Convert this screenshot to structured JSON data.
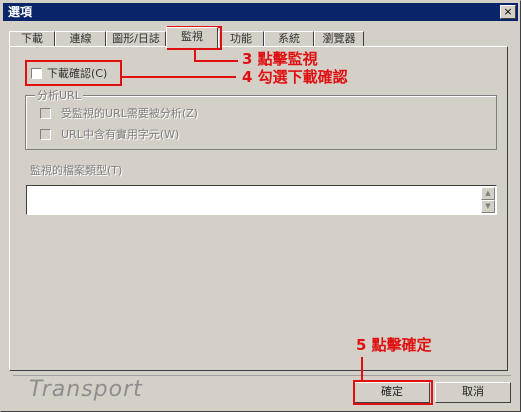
{
  "window": {
    "title": "選項",
    "close_glyph": "×"
  },
  "tabs": [
    {
      "label": "下載",
      "active": false
    },
    {
      "label": "連線",
      "active": false
    },
    {
      "label": "圖形/日誌",
      "active": false
    },
    {
      "label": "監視",
      "active": true
    },
    {
      "label": "功能",
      "active": false
    },
    {
      "label": "系統",
      "active": false
    },
    {
      "label": "瀏覽器",
      "active": false
    }
  ],
  "monitor": {
    "download_confirm_label": "下載確認(C)",
    "download_confirm_checked": false,
    "analyze_url_group": "分析URL",
    "option_monitored_url": "受監視的URL需要被分析(Z)",
    "option_url_contains": "URL中含有實用字元(W)",
    "file_types_label": "監視的檔案類型(T)",
    "file_types_value": ""
  },
  "footer": {
    "brand": "Transport",
    "ok_label": "確定",
    "cancel_label": "取消"
  },
  "annotations": {
    "step3": "3 點擊監視",
    "step4": "4 勾選下載確認",
    "step5": "5 點擊確定",
    "color": "#e01010"
  }
}
